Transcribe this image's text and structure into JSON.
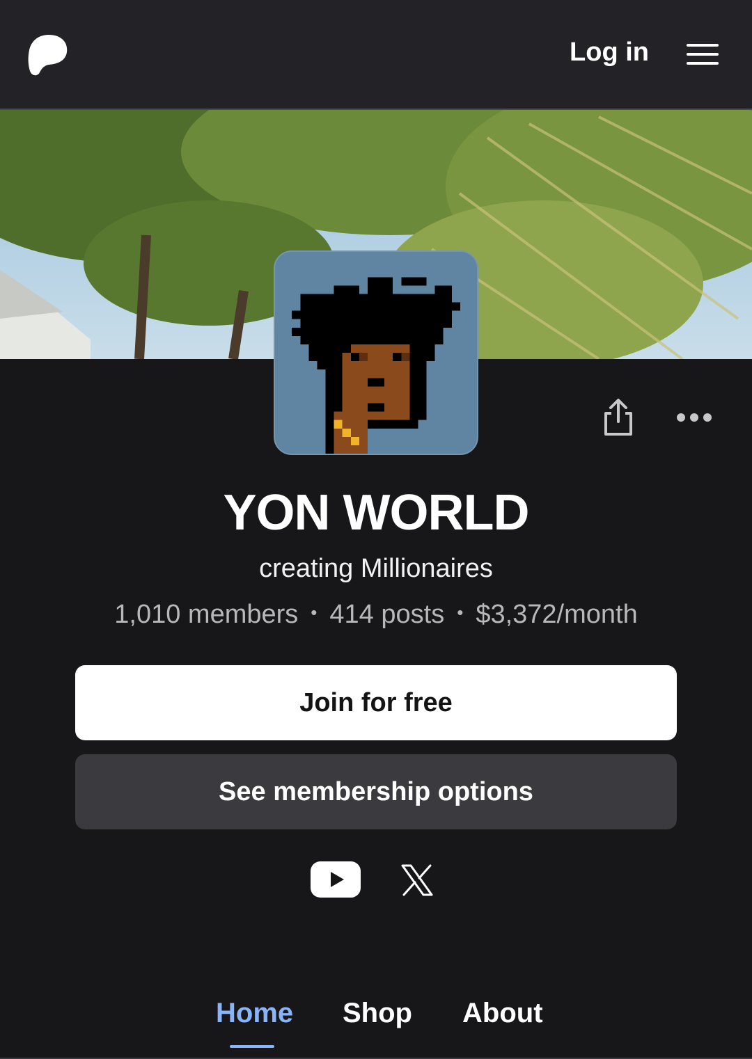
{
  "header": {
    "logo_icon": "patreon-logo-icon",
    "login_label": "Log in",
    "menu_icon": "hamburger-menu-icon"
  },
  "creator": {
    "name": "YON WORLD",
    "tagline": "creating Millionaires",
    "stats": {
      "members": "1,010 members",
      "posts": "414 posts",
      "earnings": "$3,372/month",
      "separator": "•"
    }
  },
  "actions": {
    "share_icon": "share-icon",
    "more_icon": "more-options-icon",
    "join_label": "Join for free",
    "membership_label": "See membership options"
  },
  "social": [
    {
      "name": "youtube",
      "icon": "youtube-icon"
    },
    {
      "name": "x",
      "icon": "x-logo-icon"
    }
  ],
  "tabs": [
    {
      "label": "Home",
      "active": true
    },
    {
      "label": "Shop",
      "active": false
    },
    {
      "label": "About",
      "active": false
    }
  ],
  "colors": {
    "background": "#17171a",
    "header": "#232327",
    "accent": "#8ab4f8",
    "secondary_button": "#3b3b3f",
    "avatar_bg": "#5f85a2"
  }
}
